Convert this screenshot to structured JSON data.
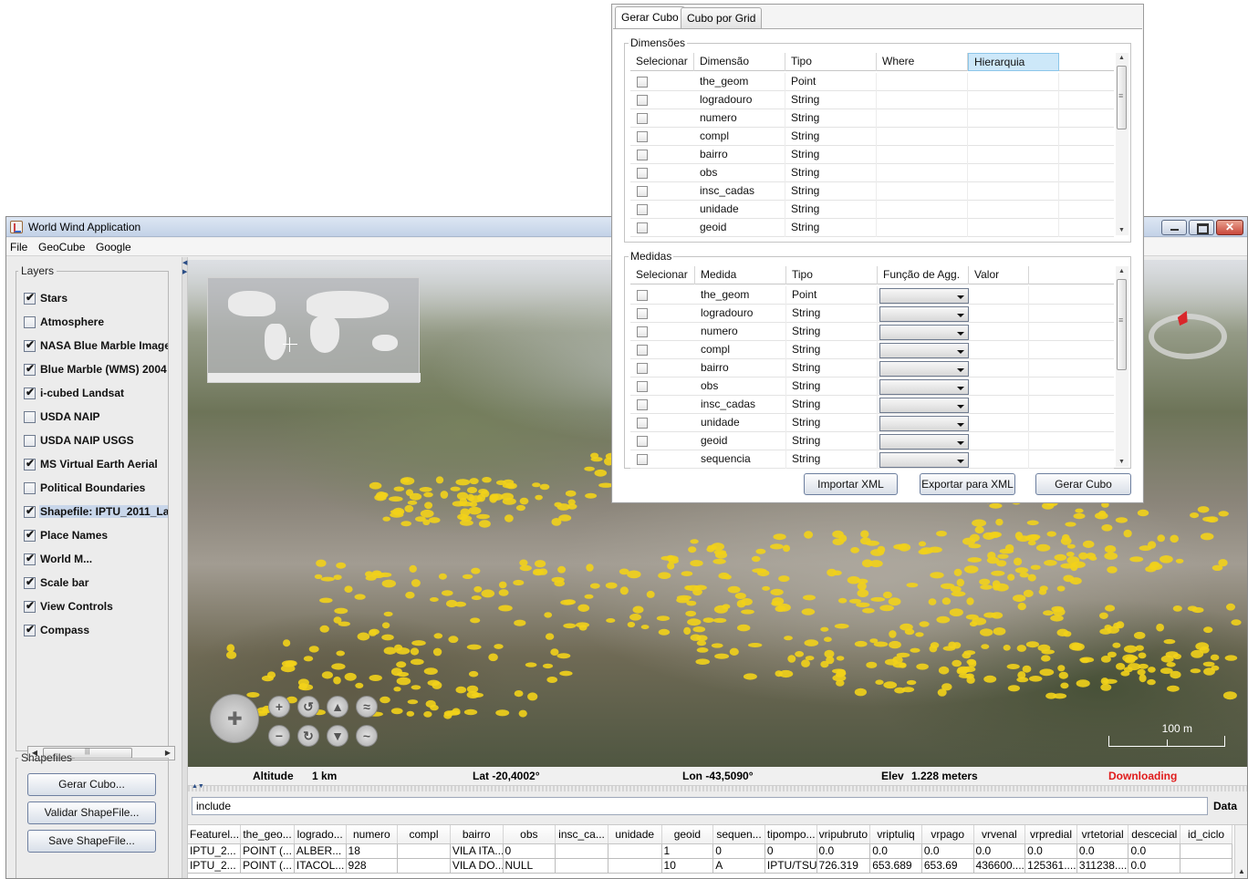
{
  "app": {
    "title": "World Wind Application"
  },
  "menu": [
    "File",
    "GeoCube",
    "Google"
  ],
  "layers": {
    "title": "Layers",
    "items": [
      {
        "label": "Stars",
        "checked": true
      },
      {
        "label": "Atmosphere",
        "checked": false
      },
      {
        "label": "NASA Blue Marble Image",
        "checked": true
      },
      {
        "label": "Blue Marble (WMS) 2004",
        "checked": true
      },
      {
        "label": "i-cubed Landsat",
        "checked": true
      },
      {
        "label": "USDA NAIP",
        "checked": false
      },
      {
        "label": "USDA NAIP USGS",
        "checked": false
      },
      {
        "label": "MS Virtual Earth Aerial",
        "checked": true
      },
      {
        "label": "Political Boundaries",
        "checked": false
      },
      {
        "label": "Shapefile: IPTU_2011_La",
        "checked": true,
        "selected": true
      },
      {
        "label": "Place Names",
        "checked": true
      },
      {
        "label": "World M...",
        "checked": true
      },
      {
        "label": "Scale bar",
        "checked": true
      },
      {
        "label": "View Controls",
        "checked": true
      },
      {
        "label": "Compass",
        "checked": true
      }
    ]
  },
  "shapefiles": {
    "title": "Shapefiles",
    "buttons": [
      "Gerar Cubo...",
      "Validar ShapeFile...",
      "Save ShapeFile..."
    ]
  },
  "map": {
    "scale_label": "100 m"
  },
  "status": {
    "altitude_label": "Altitude",
    "altitude_value": "1 km",
    "lat": "Lat -20,4002°",
    "lon": "Lon -43,5090°",
    "elev_label": "Elev",
    "elev_value": "1.228 meters",
    "downloading": "Downloading",
    "downloading_color": "#e01b1b"
  },
  "filter": {
    "value": "include",
    "button": "Data"
  },
  "table": {
    "columns": [
      "Featurel...",
      "the_geo...",
      "logrado...",
      "numero",
      "compl",
      "bairro",
      "obs",
      "insc_ca...",
      "unidade",
      "geoid",
      "sequen...",
      "tipompo...",
      "vripubruto",
      "vriptuliq",
      "vrpago",
      "vrvenal",
      "vrpredial",
      "vrtetorial",
      "descecial",
      "id_ciclo"
    ],
    "rows": [
      [
        "IPTU_2...",
        "POINT (...",
        "ALBER...",
        "18",
        "",
        "VILA ITA...",
        "0",
        "",
        "",
        "1",
        "0",
        "0",
        "0.0",
        "0.0",
        "0.0",
        "0.0",
        "0.0",
        "0.0",
        "0.0",
        ""
      ],
      [
        "IPTU_2...",
        "POINT (...",
        "ITACOL...",
        "928",
        "",
        "VILA DO...",
        "NULL",
        "",
        "",
        "10",
        "A",
        "IPTU/TSU",
        "726.319",
        "653.689",
        "653.69",
        "436600....",
        "125361....",
        "311238....",
        "0.0",
        ""
      ]
    ]
  },
  "dialog": {
    "tabs": [
      "Gerar Cubo",
      "Cubo por Grid"
    ],
    "dimensions": {
      "title": "Dimensões",
      "columns": [
        "Selecionar",
        "Dimensão",
        "Tipo",
        "Where",
        "Hierarquia"
      ],
      "rows": [
        {
          "name": "the_geom",
          "type": "Point"
        },
        {
          "name": "logradouro",
          "type": "String"
        },
        {
          "name": "numero",
          "type": "String"
        },
        {
          "name": "compl",
          "type": "String"
        },
        {
          "name": "bairro",
          "type": "String"
        },
        {
          "name": "obs",
          "type": "String"
        },
        {
          "name": "insc_cadas",
          "type": "String"
        },
        {
          "name": "unidade",
          "type": "String"
        },
        {
          "name": "geoid",
          "type": "String"
        }
      ]
    },
    "measures": {
      "title": "Medidas",
      "columns": [
        "Selecionar",
        "Medida",
        "Tipo",
        "Função de Agg.",
        "Valor"
      ],
      "rows": [
        {
          "name": "the_geom",
          "type": "Point"
        },
        {
          "name": "logradouro",
          "type": "String"
        },
        {
          "name": "numero",
          "type": "String"
        },
        {
          "name": "compl",
          "type": "String"
        },
        {
          "name": "bairro",
          "type": "String"
        },
        {
          "name": "obs",
          "type": "String"
        },
        {
          "name": "insc_cadas",
          "type": "String"
        },
        {
          "name": "unidade",
          "type": "String"
        },
        {
          "name": "geoid",
          "type": "String"
        },
        {
          "name": "sequencia",
          "type": "String"
        }
      ]
    },
    "buttons": [
      "Importar XML",
      "Exportar para XML",
      "Gerar Cubo"
    ]
  },
  "colors": {
    "marker_yellow": "#f2d21a",
    "selection": "#c8d6ea",
    "header_highlight": "#cde8f9"
  }
}
